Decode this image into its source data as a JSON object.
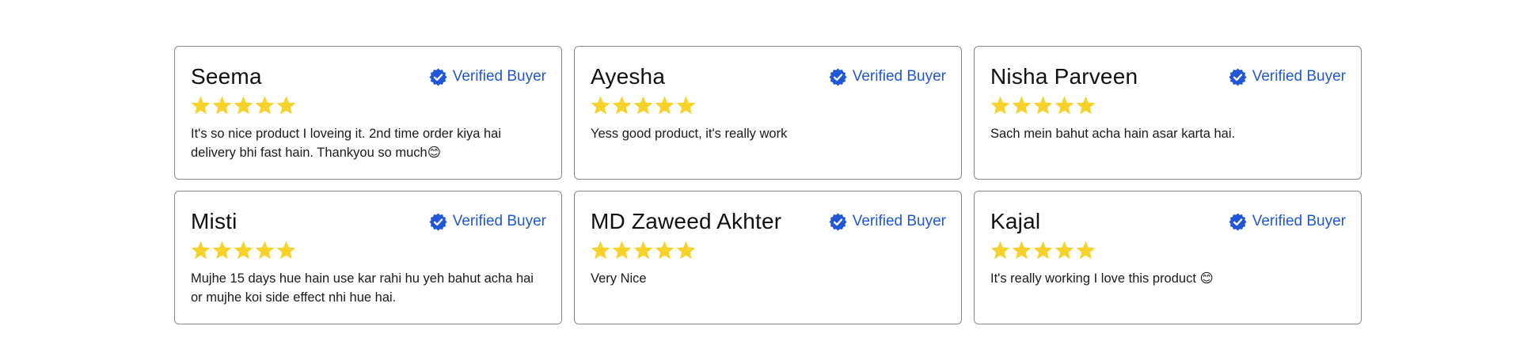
{
  "colors": {
    "accent": "#1f57d6",
    "star": "#f7d22b",
    "border": "#8a8a8a"
  },
  "icons": {
    "verified": "verified-badge-icon",
    "star": "star-icon"
  },
  "reviews": [
    {
      "name": "Seema",
      "verified_label": "Verified Buyer",
      "rating": 5,
      "text": "It's so nice product I loveing it. 2nd time order kiya hai delivery bhi fast hain. Thankyou so much😊"
    },
    {
      "name": "Ayesha",
      "verified_label": "Verified Buyer",
      "rating": 5,
      "text": "Yess good product, it's really work"
    },
    {
      "name": "Nisha Parveen",
      "verified_label": "Verified Buyer",
      "rating": 5,
      "text": "Sach mein bahut acha hain asar karta hai."
    },
    {
      "name": "Misti",
      "verified_label": "Verified Buyer",
      "rating": 5,
      "text": "Mujhe 15 days hue hain use kar rahi hu yeh bahut acha hai or mujhe koi side effect nhi hue hai."
    },
    {
      "name": "MD Zaweed Akhter",
      "verified_label": "Verified Buyer",
      "rating": 5,
      "text": "Very Nice"
    },
    {
      "name": "Kajal",
      "verified_label": "Verified Buyer",
      "rating": 5,
      "text": "It's really working I love this product 😊"
    }
  ]
}
